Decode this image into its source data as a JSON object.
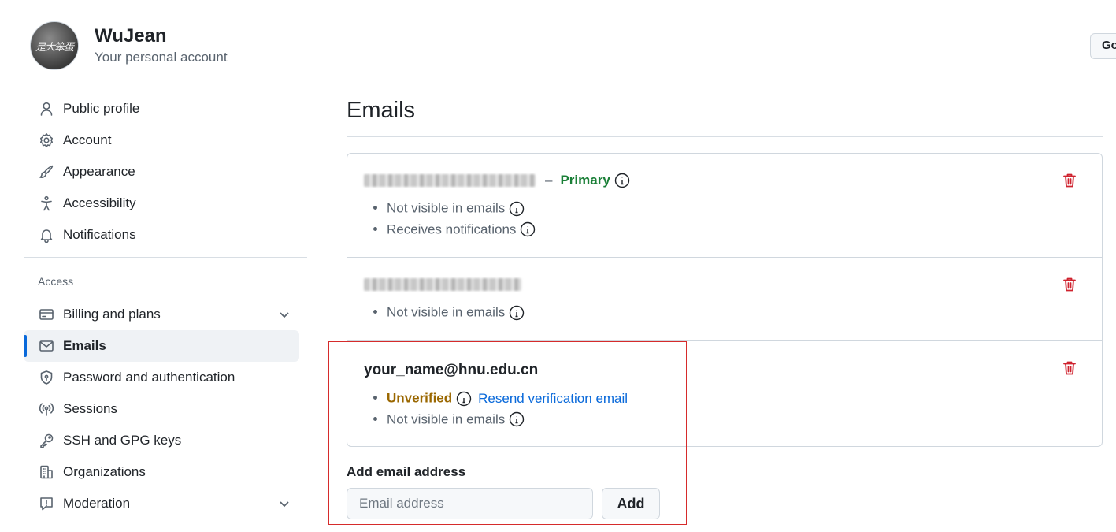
{
  "profile": {
    "avatar_text": "是大笨蛋",
    "name": "WuJean",
    "subtitle": "Your personal account"
  },
  "header": {
    "go_button_label": "Go"
  },
  "sidebar": {
    "top_items": [
      {
        "label": "Public profile",
        "icon": "person-icon"
      },
      {
        "label": "Account",
        "icon": "gear-icon"
      },
      {
        "label": "Appearance",
        "icon": "paintbrush-icon"
      },
      {
        "label": "Accessibility",
        "icon": "accessibility-icon"
      },
      {
        "label": "Notifications",
        "icon": "bell-icon"
      }
    ],
    "access_heading": "Access",
    "access_items": [
      {
        "label": "Billing and plans",
        "icon": "credit-card-icon",
        "expandable": true
      },
      {
        "label": "Emails",
        "icon": "mail-icon",
        "active": true
      },
      {
        "label": "Password and authentication",
        "icon": "shield-lock-icon"
      },
      {
        "label": "Sessions",
        "icon": "broadcast-icon"
      },
      {
        "label": "SSH and GPG keys",
        "icon": "key-icon"
      },
      {
        "label": "Organizations",
        "icon": "organization-icon"
      },
      {
        "label": "Moderation",
        "icon": "report-icon",
        "expandable": true
      }
    ]
  },
  "main": {
    "title": "Emails",
    "emails": [
      {
        "address_redacted": true,
        "primary_separator": "–",
        "primary_label": "Primary",
        "bullets": [
          "Not visible in emails",
          "Receives notifications"
        ]
      },
      {
        "address_redacted": true,
        "bullets": [
          "Not visible in emails"
        ]
      },
      {
        "address": "your_name@hnu.edu.cn",
        "status_label": "Unverified",
        "resend_link": "Resend verification email",
        "bullets": [
          "Not visible in emails"
        ]
      }
    ],
    "add_email": {
      "label": "Add email address",
      "placeholder": "Email address",
      "button_label": "Add"
    }
  },
  "colors": {
    "accent": "#0969da",
    "primary_green": "#1a7f37",
    "unverified_amber": "#9a6700",
    "danger_red": "#cf222e",
    "annotation_red": "#d62b2b"
  }
}
